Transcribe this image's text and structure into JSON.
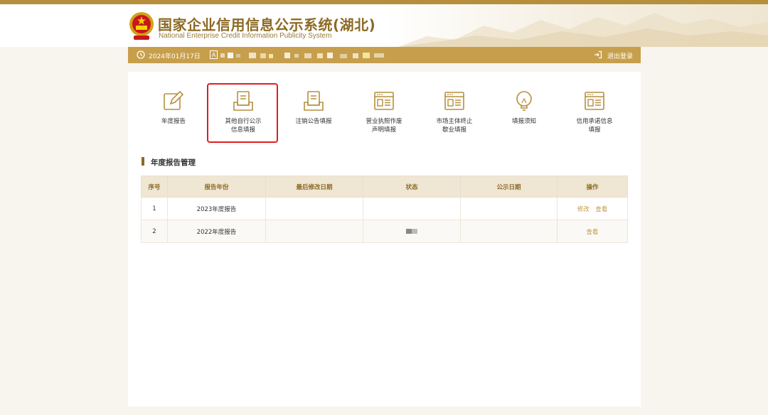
{
  "header": {
    "title_cn": "国家企业信用信息公示系统(湖北)",
    "title_en": "National Enterprise Credit Information Publicity System"
  },
  "userbar": {
    "date": "2024年01月17日",
    "logout_label": "退出登录"
  },
  "menu": [
    {
      "label": "年度报告",
      "icon": "edit-icon"
    },
    {
      "label": "其他自行公示\n信息填报",
      "icon": "document-tray-icon"
    },
    {
      "label": "注销公告填报",
      "icon": "document-tray-icon"
    },
    {
      "label": "营业执照作废\n声明填报",
      "icon": "window-form-icon"
    },
    {
      "label": "市场主体终止\n歇业填报",
      "icon": "window-form-icon"
    },
    {
      "label": "填报须知",
      "icon": "lightbulb-icon"
    },
    {
      "label": "信用承诺信息\n填报",
      "icon": "window-form-icon"
    }
  ],
  "section": {
    "title": "年度报告管理"
  },
  "table": {
    "headers": [
      "序号",
      "报告年份",
      "最后修改日期",
      "状态",
      "公示日期",
      "操作"
    ],
    "rows": [
      {
        "no": "1",
        "year": "2023年度报告",
        "modified": "",
        "status": "",
        "published": "",
        "actions": [
          "修改",
          "查看"
        ]
      },
      {
        "no": "2",
        "year": "2022年度报告",
        "modified": "",
        "status": "",
        "published": "",
        "actions": [
          "查看"
        ]
      }
    ]
  },
  "colors": {
    "gold": "#c79f4c",
    "brown": "#8c6a24",
    "highlight": "#e01f1f"
  }
}
